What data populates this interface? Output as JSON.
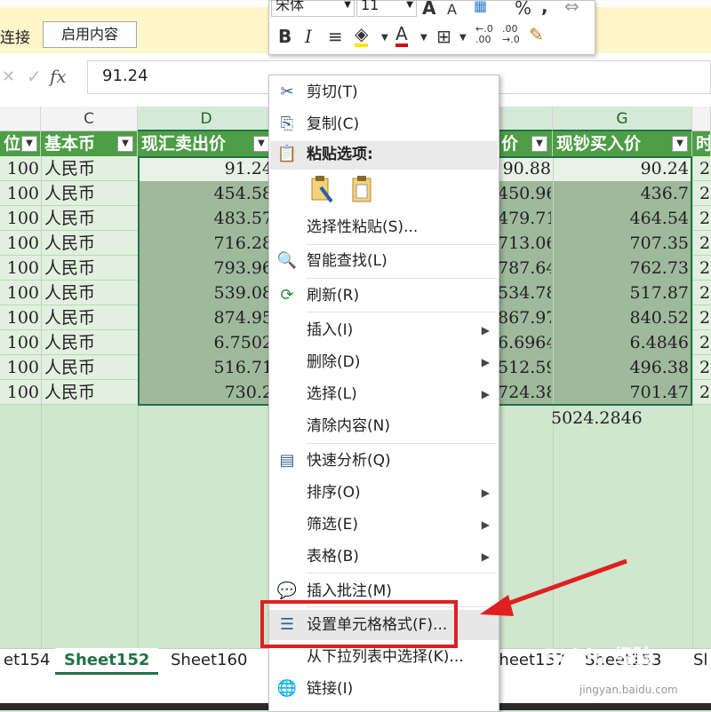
{
  "infobar": {
    "text": "连接",
    "enable_button": "启用内容"
  },
  "formula": {
    "value": "91.24",
    "fx": "fx",
    "cancel": "✕",
    "enter": "✓"
  },
  "toolbar_top": {
    "font": "宋体",
    "size": "11"
  },
  "columns": [
    {
      "id": "C",
      "label": "C"
    },
    {
      "id": "D",
      "label": "D"
    },
    {
      "id": "G",
      "label": "G"
    }
  ],
  "headers": {
    "col_b": "位",
    "col_c": "基本币",
    "col_d": "现汇卖出价",
    "col_f": "价",
    "col_g": "现钞买入价",
    "col_h": "时"
  },
  "rows": [
    {
      "b": "100",
      "c": "人民币",
      "d": "91.24",
      "f": "90.88",
      "g": "90.24",
      "h": "2"
    },
    {
      "b": "100",
      "c": "人民币",
      "d": "454.58",
      "f": "450.96",
      "g": "436.7",
      "h": "2"
    },
    {
      "b": "100",
      "c": "人民币",
      "d": "483.57",
      "f": "479.71",
      "g": "464.54",
      "h": "2"
    },
    {
      "b": "100",
      "c": "人民币",
      "d": "716.28",
      "f": "713.06",
      "g": "707.35",
      "h": "2"
    },
    {
      "b": "100",
      "c": "人民币",
      "d": "793.96",
      "f": "787.64",
      "g": "762.73",
      "h": "2"
    },
    {
      "b": "100",
      "c": "人民币",
      "d": "539.08",
      "f": "534.78",
      "g": "517.87",
      "h": "2"
    },
    {
      "b": "100",
      "c": "人民币",
      "d": "874.95",
      "f": "867.97",
      "g": "840.52",
      "h": "2"
    },
    {
      "b": "100",
      "c": "人民币",
      "d": "6.7502",
      "f": "6.6964",
      "g": "6.4846",
      "h": "2"
    },
    {
      "b": "100",
      "c": "人民币",
      "d": "516.71",
      "f": "512.59",
      "g": "496.38",
      "h": "2"
    },
    {
      "b": "100",
      "c": "人民币",
      "d": "730.2",
      "f": "724.38",
      "g": "701.47",
      "h": "2"
    }
  ],
  "sum": "5024.2846",
  "tabs": {
    "t1": "et154",
    "t2": "Sheet152",
    "t3": "Sheet160",
    "t4": "Sheet157",
    "t5": "Sheet153",
    "t6": "Sl"
  },
  "menu": {
    "cut": "剪切(T)",
    "copy": "复制(C)",
    "paste_options": "粘贴选项:",
    "paste_special": "选择性粘贴(S)...",
    "smart_lookup": "智能查找(L)",
    "refresh": "刷新(R)",
    "insert": "插入(I)",
    "delete": "删除(D)",
    "select": "选择(L)",
    "clear": "清除内容(N)",
    "quick_analysis": "快速分析(Q)",
    "sort": "排序(O)",
    "filter": "筛选(E)",
    "table": "表格(B)",
    "insert_comment": "插入批注(M)",
    "format_cells": "设置单元格格式(F)...",
    "pick_list": "从下拉列表中选择(K)...",
    "link": "链接(I)"
  },
  "watermark": "Baidu 经验",
  "watermark_url": "jingyan.baidu.com",
  "colors": {
    "accent": "#217346",
    "header_green": "#4d9e46",
    "annotation": "#e02020"
  }
}
